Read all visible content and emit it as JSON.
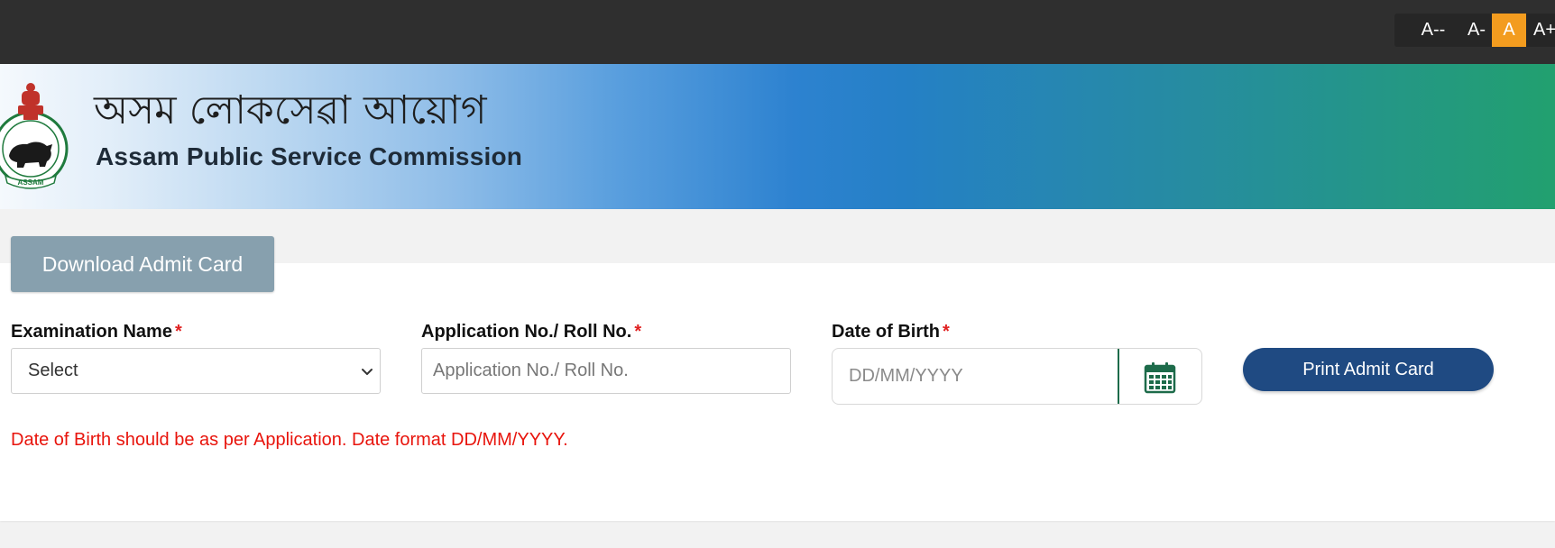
{
  "font_size_controls": [
    {
      "label": "A--",
      "active": false
    },
    {
      "label": "A-",
      "active": false
    },
    {
      "label": "A",
      "active": true
    },
    {
      "label": "A+",
      "active": false
    }
  ],
  "header": {
    "title_assamese": "অসম লোকসেৱা আয়োগ",
    "title_english": "Assam Public Service Commission",
    "emblem_text": "ASSAM"
  },
  "tab": {
    "label": "Download Admit Card"
  },
  "form": {
    "required_mark": "*",
    "exam_name": {
      "label": "Examination Name",
      "selected": "Select"
    },
    "application_no": {
      "label": "Application No./ Roll No.",
      "placeholder": "Application No./ Roll No.",
      "value": ""
    },
    "dob": {
      "label": "Date of Birth",
      "placeholder": "DD/MM/YYYY",
      "value": ""
    },
    "print_button": "Print Admit Card",
    "hint": "Date of Birth should be as per Application. Date format DD/MM/YYYY."
  },
  "colors": {
    "topbar": "#2f2f2f",
    "active_font_size": "#f39c1f",
    "tab_button": "#87a0ae",
    "print_button": "#1f4a82",
    "required": "#e02020",
    "hint": "#e8140c",
    "calendar_icon": "#1d6b4a"
  }
}
